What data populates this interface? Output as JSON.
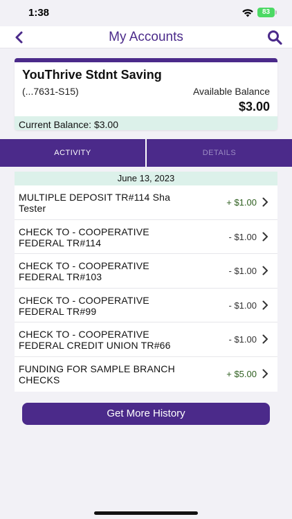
{
  "status_bar": {
    "time": "1:38",
    "battery": "83"
  },
  "nav": {
    "title": "My Accounts",
    "back_icon": "chevron-left-icon",
    "search_icon": "search-icon"
  },
  "account": {
    "name": "YouThrive Stdnt Saving",
    "number": "(...7631-S15)",
    "available_label": "Available Balance",
    "available_value": "$3.00",
    "current_balance": "Current Balance: $3.00"
  },
  "tabs": [
    {
      "label": "ACTIVITY",
      "active": true
    },
    {
      "label": "DETAILS",
      "active": false
    }
  ],
  "transactions_date": "June 13, 2023",
  "transactions": [
    {
      "description": "MULTIPLE DEPOSIT TR#114 Sha Tester",
      "amount": "+ $1.00",
      "type": "credit"
    },
    {
      "description": "CHECK TO - COOPERATIVE FEDERAL TR#114",
      "amount": "- $1.00",
      "type": "debit"
    },
    {
      "description": "CHECK TO - COOPERATIVE FEDERAL TR#103",
      "amount": "- $1.00",
      "type": "debit"
    },
    {
      "description": "CHECK TO - COOPERATIVE FEDERAL TR#99",
      "amount": "- $1.00",
      "type": "debit"
    },
    {
      "description": "CHECK TO - COOPERATIVE FEDERAL CREDIT UNION TR#66",
      "amount": "- $1.00",
      "type": "debit"
    },
    {
      "description": "FUNDING FOR SAMPLE BRANCH CHECKS",
      "amount": "+ $5.00",
      "type": "credit"
    }
  ],
  "more_history_label": "Get More History",
  "colors": {
    "brand": "#4b2a8a",
    "strip": "#dcf1ea",
    "credit": "#2d5e1e",
    "background": "#f2f1f6"
  }
}
